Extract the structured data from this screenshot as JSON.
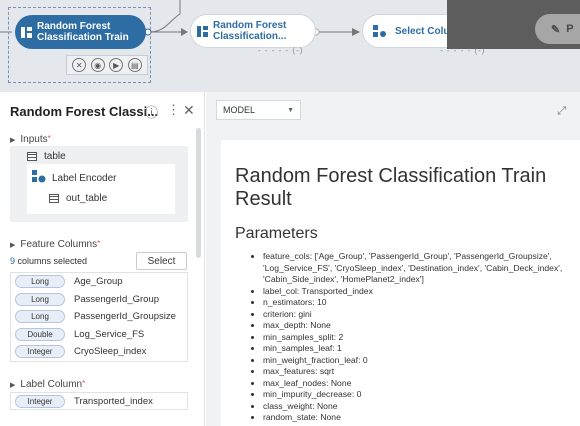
{
  "pipeline": {
    "nodes": [
      {
        "label": "Random Forest\nClassification Train",
        "sub": ""
      },
      {
        "label": "Random Forest\nClassification...",
        "sub": "- - - - - (-)"
      },
      {
        "label": "Select Colum",
        "sub": "- - - - - (-)"
      }
    ],
    "partial_label": "P"
  },
  "sidebar": {
    "title": "Random Forest Classi...",
    "inputs_label": "Inputs",
    "input_table": "table",
    "encoder": "Label Encoder",
    "out_table": "out_table",
    "feature_columns_label": "Feature Columns",
    "selected_count": "9",
    "selected_suffix": "columns selected",
    "select_button": "Select",
    "columns": [
      {
        "type": "Long",
        "name": "Age_Group"
      },
      {
        "type": "Long",
        "name": "PassengerId_Group"
      },
      {
        "type": "Long",
        "name": "PassengerId_Groupsize"
      },
      {
        "type": "Double",
        "name": "Log_Service_FS"
      },
      {
        "type": "Integer",
        "name": "CryoSleep_index"
      }
    ],
    "label_column_label": "Label Column",
    "label_column": {
      "type": "Integer",
      "name": "Transported_index"
    }
  },
  "result": {
    "dropdown": "MODEL",
    "title": "Random Forest Classification Train Result",
    "params_heading": "Parameters",
    "params": [
      "feature_cols: ['Age_Group', 'PassengerId_Group', 'PassengerId_Groupsize', 'Log_Service_FS', 'CryoSleep_index', 'Destination_index', 'Cabin_Deck_index', 'Cabin_Side_index', 'HomePlanet2_index']",
      "label_col: Transported_index",
      "n_estimators: 10",
      "criterion: gini",
      "max_depth: None",
      "min_samples_split: 2",
      "min_samples_leaf: 1",
      "min_weight_fraction_leaf: 0",
      "max_features: sqrt",
      "max_leaf_nodes: None",
      "min_impurity_decrease: 0",
      "class_weight: None",
      "random_state: None"
    ]
  }
}
